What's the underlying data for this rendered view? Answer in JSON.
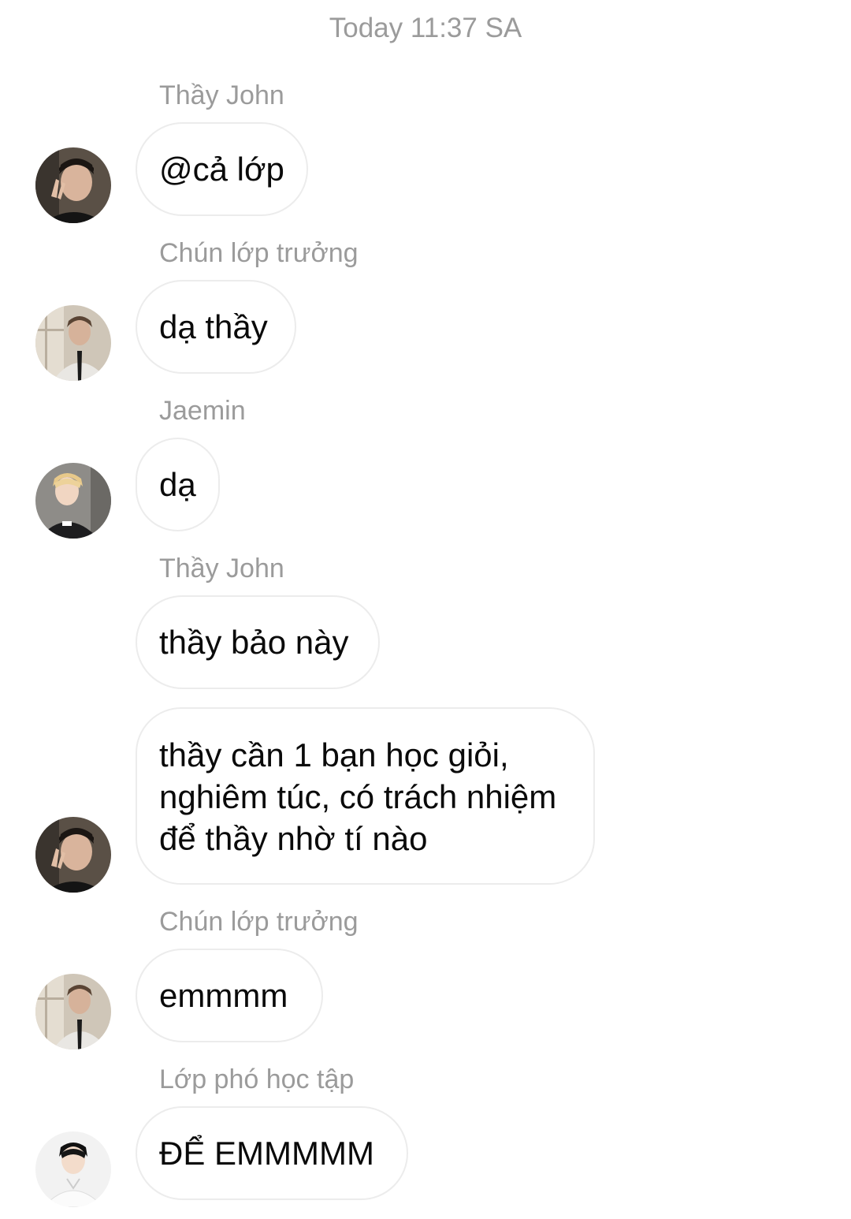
{
  "timestamp": "Today 11:37 SA",
  "messages": [
    {
      "sender": "Thầy John",
      "text": "@cả lớp"
    },
    {
      "sender": "Chún lớp trưởng",
      "text": "dạ thầy"
    },
    {
      "sender": "Jaemin",
      "text": "dạ"
    },
    {
      "sender": "Thầy John",
      "texts": [
        "thầy bảo này",
        "thầy cần 1 bạn học giỏi, nghiêm túc, có trách nhiệm để thầy nhờ tí nào"
      ]
    },
    {
      "sender": "Chún lớp trưởng",
      "text": "emmmm"
    },
    {
      "sender": "Lớp phó học tập",
      "text": "ĐỂ EMMMMM"
    }
  ]
}
